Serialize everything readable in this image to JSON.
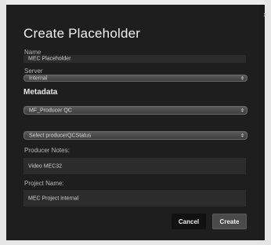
{
  "dialog": {
    "title": "Create Placeholder",
    "close_glyph": "×"
  },
  "fields": {
    "name_label": "Name",
    "name_value": "MEC Placeholder",
    "server_label": "Server",
    "server_value": "Internal",
    "metadata_heading": "Metadata",
    "metadata_template_value": "MF_Producer QC",
    "qc_status_value": "Select producerQCStatus",
    "producer_notes_label": "Producer Notes:",
    "producer_notes_value": "Video MEC32",
    "project_name_label": "Project Name:",
    "project_name_value": "MEC Project internal"
  },
  "buttons": {
    "cancel": "Cancel",
    "create": "Create"
  },
  "icons": {
    "select_arrow": "chevron-updown-icon",
    "close": "close-icon"
  },
  "colors": {
    "dialog_bg": "#1e1e1e",
    "field_bg": "#2c2c2c",
    "create_button_bg": "#4a4a4a"
  }
}
